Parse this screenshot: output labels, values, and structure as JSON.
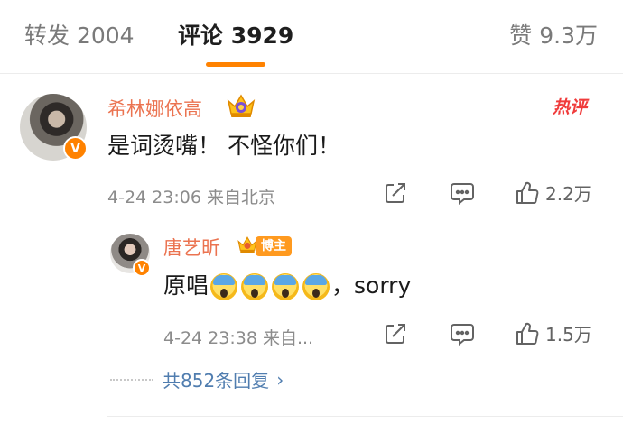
{
  "tabs": {
    "repost": "转发 2004",
    "comment": "评论 3929",
    "like": "赞 9.3万"
  },
  "comment": {
    "username": "希林娜依高",
    "hot_label": "热评",
    "text": "是词烫嘴！ 不怪你们！",
    "meta": "4-24 23:06  来自北京",
    "like_count": "2.2万",
    "verified_mark": "V"
  },
  "reply": {
    "username": "唐艺昕",
    "badge": "博主",
    "text_before": "原唱",
    "text_after": "，sorry",
    "emoji_count": 4,
    "meta": "4-24 23:38  来自...",
    "like_count": "1.5万",
    "verified_mark": "V"
  },
  "more_replies": {
    "label": "共852条回复",
    "chevron": "›"
  },
  "icons": {
    "share": "share-icon",
    "comment": "comment-icon",
    "like": "thumbs-up-icon",
    "crown": "crown-icon",
    "emoji": "scream-emoji"
  },
  "colors": {
    "accent": "#ff8200",
    "username": "#eb7350",
    "link": "#507daf",
    "hot": "#f03c3c"
  }
}
